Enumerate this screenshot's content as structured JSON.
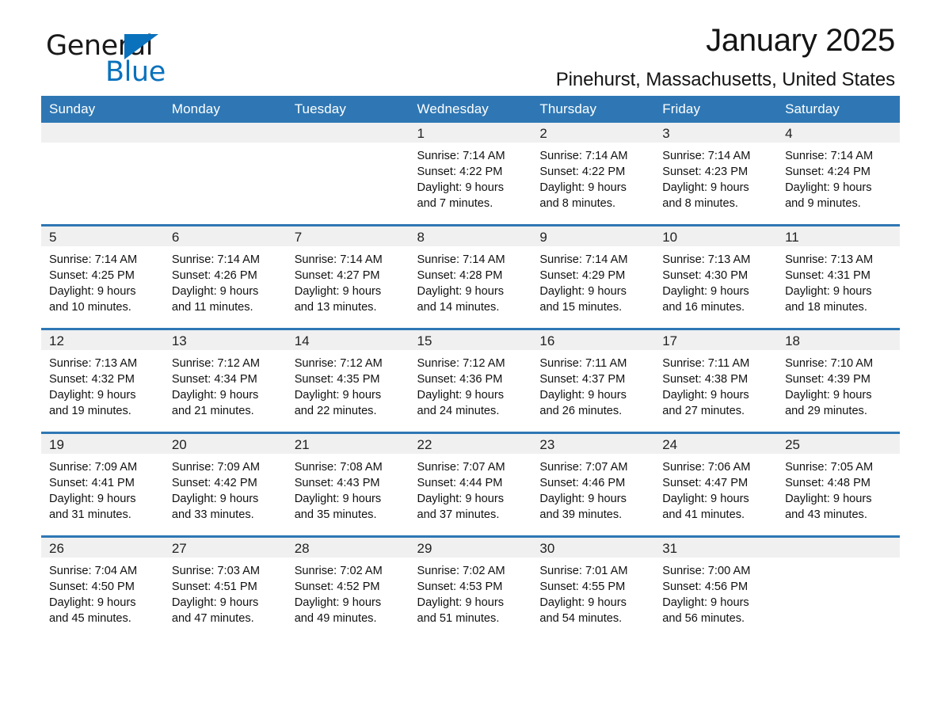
{
  "brand": {
    "name_part1": "General",
    "name_part2": "Blue",
    "triangle_icon": "brand-triangle-icon",
    "accent_color": "#0a72bd"
  },
  "header": {
    "month_title": "January 2025",
    "location": "Pinehurst, Massachusetts, United States"
  },
  "calendar": {
    "header_color": "#2e77b4",
    "daynum_strip_color": "#f0f0f0",
    "weekday_headers": [
      "Sunday",
      "Monday",
      "Tuesday",
      "Wednesday",
      "Thursday",
      "Friday",
      "Saturday"
    ],
    "weeks": [
      [
        {
          "day": "",
          "empty": true,
          "sunrise": "",
          "sunset": "",
          "daylight_line1": "",
          "daylight_line2": ""
        },
        {
          "day": "",
          "empty": true,
          "sunrise": "",
          "sunset": "",
          "daylight_line1": "",
          "daylight_line2": ""
        },
        {
          "day": "",
          "empty": true,
          "sunrise": "",
          "sunset": "",
          "daylight_line1": "",
          "daylight_line2": ""
        },
        {
          "day": "1",
          "empty": false,
          "sunrise": "Sunrise: 7:14 AM",
          "sunset": "Sunset: 4:22 PM",
          "daylight_line1": "Daylight: 9 hours",
          "daylight_line2": "and 7 minutes."
        },
        {
          "day": "2",
          "empty": false,
          "sunrise": "Sunrise: 7:14 AM",
          "sunset": "Sunset: 4:22 PM",
          "daylight_line1": "Daylight: 9 hours",
          "daylight_line2": "and 8 minutes."
        },
        {
          "day": "3",
          "empty": false,
          "sunrise": "Sunrise: 7:14 AM",
          "sunset": "Sunset: 4:23 PM",
          "daylight_line1": "Daylight: 9 hours",
          "daylight_line2": "and 8 minutes."
        },
        {
          "day": "4",
          "empty": false,
          "sunrise": "Sunrise: 7:14 AM",
          "sunset": "Sunset: 4:24 PM",
          "daylight_line1": "Daylight: 9 hours",
          "daylight_line2": "and 9 minutes."
        }
      ],
      [
        {
          "day": "5",
          "empty": false,
          "sunrise": "Sunrise: 7:14 AM",
          "sunset": "Sunset: 4:25 PM",
          "daylight_line1": "Daylight: 9 hours",
          "daylight_line2": "and 10 minutes."
        },
        {
          "day": "6",
          "empty": false,
          "sunrise": "Sunrise: 7:14 AM",
          "sunset": "Sunset: 4:26 PM",
          "daylight_line1": "Daylight: 9 hours",
          "daylight_line2": "and 11 minutes."
        },
        {
          "day": "7",
          "empty": false,
          "sunrise": "Sunrise: 7:14 AM",
          "sunset": "Sunset: 4:27 PM",
          "daylight_line1": "Daylight: 9 hours",
          "daylight_line2": "and 13 minutes."
        },
        {
          "day": "8",
          "empty": false,
          "sunrise": "Sunrise: 7:14 AM",
          "sunset": "Sunset: 4:28 PM",
          "daylight_line1": "Daylight: 9 hours",
          "daylight_line2": "and 14 minutes."
        },
        {
          "day": "9",
          "empty": false,
          "sunrise": "Sunrise: 7:14 AM",
          "sunset": "Sunset: 4:29 PM",
          "daylight_line1": "Daylight: 9 hours",
          "daylight_line2": "and 15 minutes."
        },
        {
          "day": "10",
          "empty": false,
          "sunrise": "Sunrise: 7:13 AM",
          "sunset": "Sunset: 4:30 PM",
          "daylight_line1": "Daylight: 9 hours",
          "daylight_line2": "and 16 minutes."
        },
        {
          "day": "11",
          "empty": false,
          "sunrise": "Sunrise: 7:13 AM",
          "sunset": "Sunset: 4:31 PM",
          "daylight_line1": "Daylight: 9 hours",
          "daylight_line2": "and 18 minutes."
        }
      ],
      [
        {
          "day": "12",
          "empty": false,
          "sunrise": "Sunrise: 7:13 AM",
          "sunset": "Sunset: 4:32 PM",
          "daylight_line1": "Daylight: 9 hours",
          "daylight_line2": "and 19 minutes."
        },
        {
          "day": "13",
          "empty": false,
          "sunrise": "Sunrise: 7:12 AM",
          "sunset": "Sunset: 4:34 PM",
          "daylight_line1": "Daylight: 9 hours",
          "daylight_line2": "and 21 minutes."
        },
        {
          "day": "14",
          "empty": false,
          "sunrise": "Sunrise: 7:12 AM",
          "sunset": "Sunset: 4:35 PM",
          "daylight_line1": "Daylight: 9 hours",
          "daylight_line2": "and 22 minutes."
        },
        {
          "day": "15",
          "empty": false,
          "sunrise": "Sunrise: 7:12 AM",
          "sunset": "Sunset: 4:36 PM",
          "daylight_line1": "Daylight: 9 hours",
          "daylight_line2": "and 24 minutes."
        },
        {
          "day": "16",
          "empty": false,
          "sunrise": "Sunrise: 7:11 AM",
          "sunset": "Sunset: 4:37 PM",
          "daylight_line1": "Daylight: 9 hours",
          "daylight_line2": "and 26 minutes."
        },
        {
          "day": "17",
          "empty": false,
          "sunrise": "Sunrise: 7:11 AM",
          "sunset": "Sunset: 4:38 PM",
          "daylight_line1": "Daylight: 9 hours",
          "daylight_line2": "and 27 minutes."
        },
        {
          "day": "18",
          "empty": false,
          "sunrise": "Sunrise: 7:10 AM",
          "sunset": "Sunset: 4:39 PM",
          "daylight_line1": "Daylight: 9 hours",
          "daylight_line2": "and 29 minutes."
        }
      ],
      [
        {
          "day": "19",
          "empty": false,
          "sunrise": "Sunrise: 7:09 AM",
          "sunset": "Sunset: 4:41 PM",
          "daylight_line1": "Daylight: 9 hours",
          "daylight_line2": "and 31 minutes."
        },
        {
          "day": "20",
          "empty": false,
          "sunrise": "Sunrise: 7:09 AM",
          "sunset": "Sunset: 4:42 PM",
          "daylight_line1": "Daylight: 9 hours",
          "daylight_line2": "and 33 minutes."
        },
        {
          "day": "21",
          "empty": false,
          "sunrise": "Sunrise: 7:08 AM",
          "sunset": "Sunset: 4:43 PM",
          "daylight_line1": "Daylight: 9 hours",
          "daylight_line2": "and 35 minutes."
        },
        {
          "day": "22",
          "empty": false,
          "sunrise": "Sunrise: 7:07 AM",
          "sunset": "Sunset: 4:44 PM",
          "daylight_line1": "Daylight: 9 hours",
          "daylight_line2": "and 37 minutes."
        },
        {
          "day": "23",
          "empty": false,
          "sunrise": "Sunrise: 7:07 AM",
          "sunset": "Sunset: 4:46 PM",
          "daylight_line1": "Daylight: 9 hours",
          "daylight_line2": "and 39 minutes."
        },
        {
          "day": "24",
          "empty": false,
          "sunrise": "Sunrise: 7:06 AM",
          "sunset": "Sunset: 4:47 PM",
          "daylight_line1": "Daylight: 9 hours",
          "daylight_line2": "and 41 minutes."
        },
        {
          "day": "25",
          "empty": false,
          "sunrise": "Sunrise: 7:05 AM",
          "sunset": "Sunset: 4:48 PM",
          "daylight_line1": "Daylight: 9 hours",
          "daylight_line2": "and 43 minutes."
        }
      ],
      [
        {
          "day": "26",
          "empty": false,
          "sunrise": "Sunrise: 7:04 AM",
          "sunset": "Sunset: 4:50 PM",
          "daylight_line1": "Daylight: 9 hours",
          "daylight_line2": "and 45 minutes."
        },
        {
          "day": "27",
          "empty": false,
          "sunrise": "Sunrise: 7:03 AM",
          "sunset": "Sunset: 4:51 PM",
          "daylight_line1": "Daylight: 9 hours",
          "daylight_line2": "and 47 minutes."
        },
        {
          "day": "28",
          "empty": false,
          "sunrise": "Sunrise: 7:02 AM",
          "sunset": "Sunset: 4:52 PM",
          "daylight_line1": "Daylight: 9 hours",
          "daylight_line2": "and 49 minutes."
        },
        {
          "day": "29",
          "empty": false,
          "sunrise": "Sunrise: 7:02 AM",
          "sunset": "Sunset: 4:53 PM",
          "daylight_line1": "Daylight: 9 hours",
          "daylight_line2": "and 51 minutes."
        },
        {
          "day": "30",
          "empty": false,
          "sunrise": "Sunrise: 7:01 AM",
          "sunset": "Sunset: 4:55 PM",
          "daylight_line1": "Daylight: 9 hours",
          "daylight_line2": "and 54 minutes."
        },
        {
          "day": "31",
          "empty": false,
          "sunrise": "Sunrise: 7:00 AM",
          "sunset": "Sunset: 4:56 PM",
          "daylight_line1": "Daylight: 9 hours",
          "daylight_line2": "and 56 minutes."
        },
        {
          "day": "",
          "empty": true,
          "sunrise": "",
          "sunset": "",
          "daylight_line1": "",
          "daylight_line2": ""
        }
      ]
    ]
  }
}
